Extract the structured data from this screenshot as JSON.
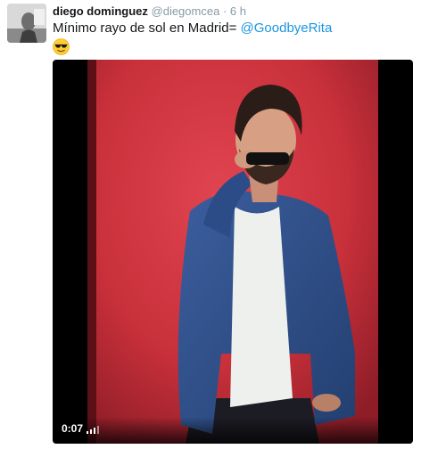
{
  "tweet": {
    "display_name": "diego dominguez",
    "handle": "@diegomcea",
    "separator": "·",
    "timestamp": "6 h",
    "text": "Mínimo rayo de sol en Madrid=",
    "mention": "@GoodbyeRita",
    "emoji": "sunglasses-emoji"
  },
  "media": {
    "type": "video",
    "duration": "0:07",
    "indicator_icon": "volume-bars-icon"
  },
  "colors": {
    "name": "#14171a",
    "meta": "#8899a6",
    "link": "#1b95e0",
    "wall": "#c8303a",
    "jacket": "#2f4f8a"
  }
}
